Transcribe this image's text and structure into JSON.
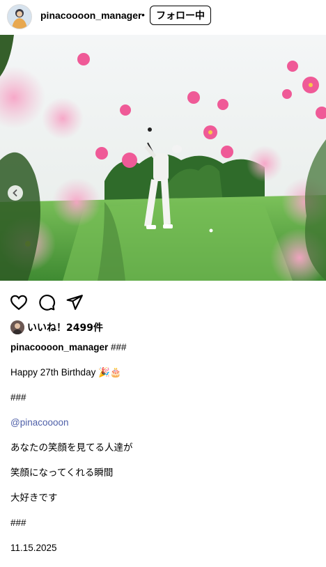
{
  "header": {
    "username": "pinacoooon_manager",
    "separator": "•",
    "follow_label": "フォロー中"
  },
  "carousel": {
    "total": 3,
    "active_index": 2
  },
  "icons": {
    "like": "heart-icon",
    "comment": "comment-icon",
    "share": "paper-plane-icon",
    "prev": "chevron-left-icon",
    "tag": "user-tag-icon"
  },
  "likes": {
    "text": "いいね！2499件"
  },
  "caption": {
    "username": "pinacoooon_manager",
    "first_line_rest": " ###",
    "lines": [
      "Happy 27th Birthday 🎉🎂",
      "###",
      "@pinacoooon",
      "あなたの笑顔を見てる人達が",
      "笑顔になってくれる瞬間",
      "大好きです",
      "###",
      "11.15.2025"
    ]
  },
  "colors": {
    "mention": "#4e5fa8",
    "cosmos_pink": "#f06aa0",
    "grass": "#5fa84a"
  }
}
